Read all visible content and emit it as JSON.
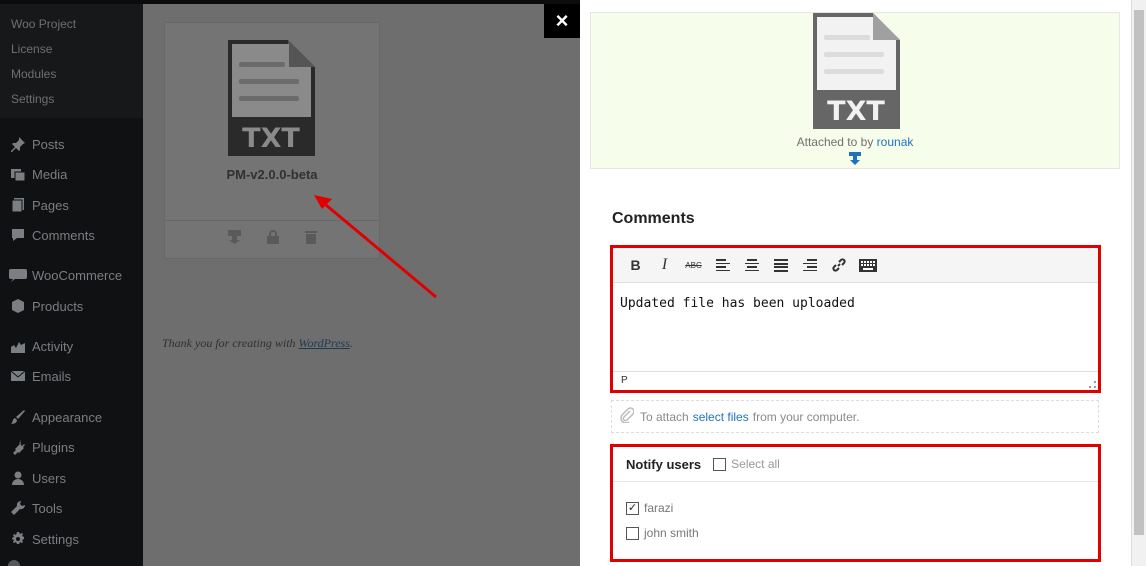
{
  "sidebar": {
    "submenu": [
      "Woo Project",
      "License",
      "Modules",
      "Settings"
    ],
    "items": [
      {
        "label": "Posts",
        "icon": "pin-icon"
      },
      {
        "label": "Media",
        "icon": "media-icon"
      },
      {
        "label": "Pages",
        "icon": "pages-icon"
      },
      {
        "label": "Comments",
        "icon": "comment-icon"
      },
      {
        "label": "WooCommerce",
        "icon": "woo-icon"
      },
      {
        "label": "Products",
        "icon": "products-icon"
      },
      {
        "label": "Activity",
        "icon": "activity-icon"
      },
      {
        "label": "Emails",
        "icon": "email-icon"
      },
      {
        "label": "Appearance",
        "icon": "brush-icon"
      },
      {
        "label": "Plugins",
        "icon": "plugin-icon"
      },
      {
        "label": "Users",
        "icon": "user-icon"
      },
      {
        "label": "Tools",
        "icon": "wrench-icon"
      },
      {
        "label": "Settings",
        "icon": "settings-icon"
      }
    ]
  },
  "card": {
    "file_type": "TXT",
    "file_name": "PM-v2.0.0-beta"
  },
  "footer": {
    "thanks_text": "Thank you for creating with",
    "thanks_link": "WordPress",
    "thanks_end": "."
  },
  "modal": {
    "close_label": "×",
    "preview": {
      "file_type": "TXT",
      "attached_text": "Attached to by",
      "attached_user": "rounak"
    },
    "comments_title": "Comments",
    "editor": {
      "content": "Updated file has been uploaded",
      "status_path": "P"
    },
    "attach": {
      "prefix": "To attach",
      "link": "select files",
      "suffix": "from your computer."
    },
    "notify": {
      "title": "Notify users",
      "select_all_label": "Select all",
      "select_all_checked": false,
      "users": [
        {
          "name": "farazi",
          "checked": true
        },
        {
          "name": "john smith",
          "checked": false
        }
      ]
    }
  },
  "colors": {
    "highlight_border": "#e00000",
    "link": "#1e73be",
    "preview_bg": "#f7fdeb"
  }
}
